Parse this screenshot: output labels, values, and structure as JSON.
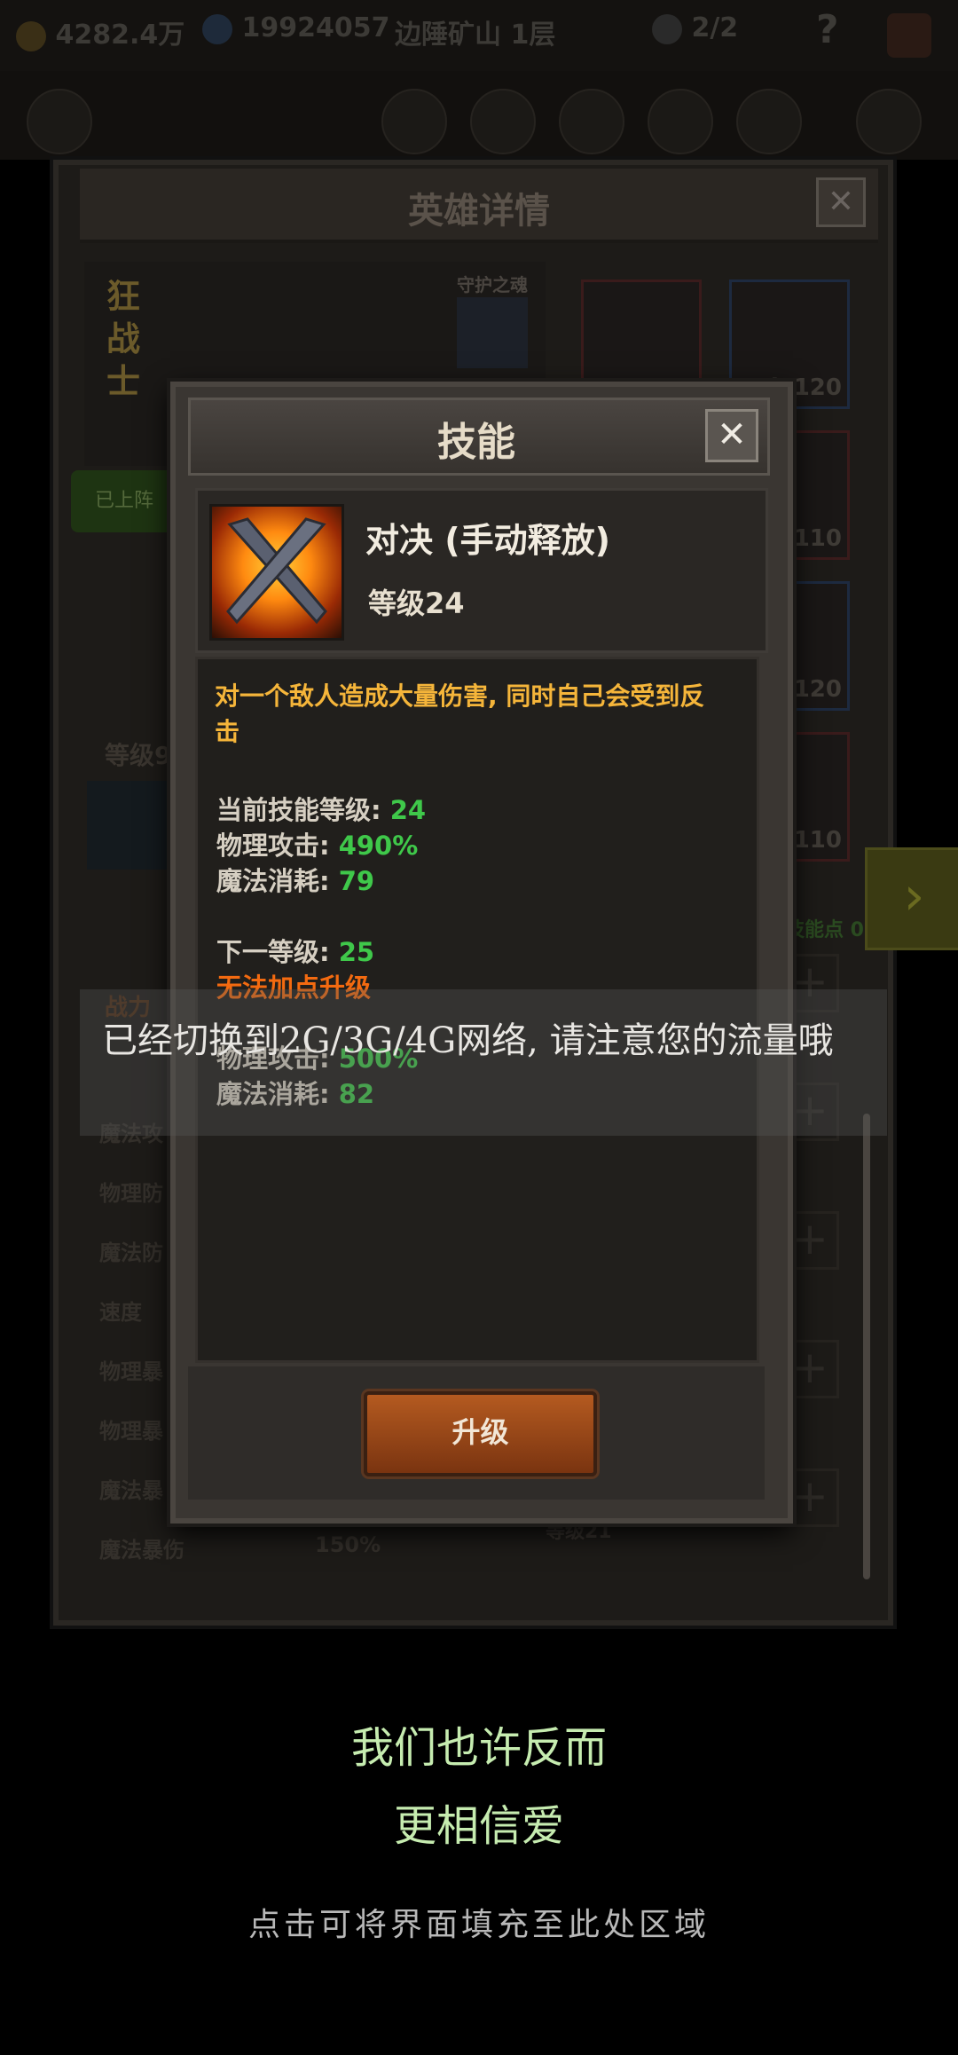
{
  "topbar": {
    "gold": "4282.4万",
    "gems": "19924057",
    "location": "边陲矿山 1层",
    "skulls": "2/2",
    "help": "?"
  },
  "hero_window": {
    "title": "英雄详情",
    "close": "✕",
    "class_name": "狂战士",
    "guard_label": "守护之魂",
    "on_field": "已上阵",
    "level_label": "等级9",
    "power_label": "战力",
    "equip_levels": [
      "lv120",
      "lv110",
      "lv120",
      "lv110"
    ],
    "stats": [
      {
        "label": "魔法攻"
      },
      {
        "label": "物理防"
      },
      {
        "label": "魔法防"
      },
      {
        "label": "速度"
      },
      {
        "label": "物理暴"
      },
      {
        "label": "物理暴"
      },
      {
        "label": "魔法暴"
      },
      {
        "label": "魔法暴伤",
        "value": "150%"
      }
    ],
    "skill_points": "技能点 0",
    "skill_row_level": "等级21"
  },
  "skill_dialog": {
    "title": "技能",
    "close": "✕",
    "skill_name": "对决 (手动释放)",
    "skill_level": "等级24",
    "description": "对一个敌人造成大量伤害, 同时自己会受到反击",
    "current_level_label": "当前技能等级: ",
    "current_level_value": "24",
    "phys_attack_label": "物理攻击: ",
    "phys_attack_value": "490%",
    "mana_cost_label": "魔法消耗: ",
    "mana_cost_value": "79",
    "next_level_label": "下一等级: ",
    "next_level_value": "25",
    "cannot_upgrade": "无法加点升级",
    "next_phys_attack_label": "物理攻击: ",
    "next_phys_attack_value": "500%",
    "next_mana_cost_label": "魔法消耗: ",
    "next_mana_cost_value": "82",
    "upgrade_button": "升级"
  },
  "toast": {
    "text": "已经切换到2G/3G/4G网络, 请注意您的流量哦"
  },
  "bottom": {
    "line1": "我们也许反而",
    "line2": "更相信爱",
    "fill_hint": "点击可将界面填充至此处区域"
  }
}
